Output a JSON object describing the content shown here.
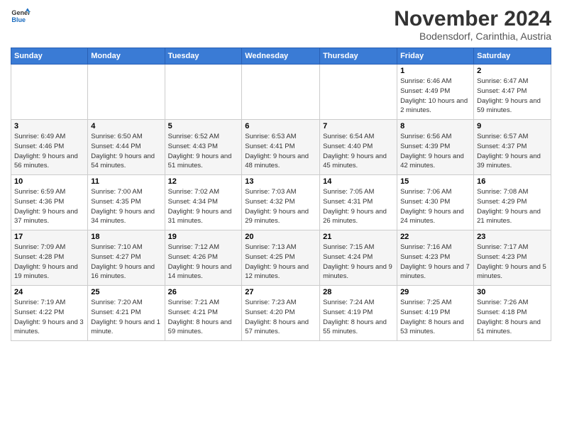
{
  "logo": {
    "text_general": "General",
    "text_blue": "Blue"
  },
  "header": {
    "month_year": "November 2024",
    "location": "Bodensdorf, Carinthia, Austria"
  },
  "weekdays": [
    "Sunday",
    "Monday",
    "Tuesday",
    "Wednesday",
    "Thursday",
    "Friday",
    "Saturday"
  ],
  "weeks": [
    [
      {
        "day": "",
        "info": ""
      },
      {
        "day": "",
        "info": ""
      },
      {
        "day": "",
        "info": ""
      },
      {
        "day": "",
        "info": ""
      },
      {
        "day": "",
        "info": ""
      },
      {
        "day": "1",
        "info": "Sunrise: 6:46 AM\nSunset: 4:49 PM\nDaylight: 10 hours and 2 minutes."
      },
      {
        "day": "2",
        "info": "Sunrise: 6:47 AM\nSunset: 4:47 PM\nDaylight: 9 hours and 59 minutes."
      }
    ],
    [
      {
        "day": "3",
        "info": "Sunrise: 6:49 AM\nSunset: 4:46 PM\nDaylight: 9 hours and 56 minutes."
      },
      {
        "day": "4",
        "info": "Sunrise: 6:50 AM\nSunset: 4:44 PM\nDaylight: 9 hours and 54 minutes."
      },
      {
        "day": "5",
        "info": "Sunrise: 6:52 AM\nSunset: 4:43 PM\nDaylight: 9 hours and 51 minutes."
      },
      {
        "day": "6",
        "info": "Sunrise: 6:53 AM\nSunset: 4:41 PM\nDaylight: 9 hours and 48 minutes."
      },
      {
        "day": "7",
        "info": "Sunrise: 6:54 AM\nSunset: 4:40 PM\nDaylight: 9 hours and 45 minutes."
      },
      {
        "day": "8",
        "info": "Sunrise: 6:56 AM\nSunset: 4:39 PM\nDaylight: 9 hours and 42 minutes."
      },
      {
        "day": "9",
        "info": "Sunrise: 6:57 AM\nSunset: 4:37 PM\nDaylight: 9 hours and 39 minutes."
      }
    ],
    [
      {
        "day": "10",
        "info": "Sunrise: 6:59 AM\nSunset: 4:36 PM\nDaylight: 9 hours and 37 minutes."
      },
      {
        "day": "11",
        "info": "Sunrise: 7:00 AM\nSunset: 4:35 PM\nDaylight: 9 hours and 34 minutes."
      },
      {
        "day": "12",
        "info": "Sunrise: 7:02 AM\nSunset: 4:34 PM\nDaylight: 9 hours and 31 minutes."
      },
      {
        "day": "13",
        "info": "Sunrise: 7:03 AM\nSunset: 4:32 PM\nDaylight: 9 hours and 29 minutes."
      },
      {
        "day": "14",
        "info": "Sunrise: 7:05 AM\nSunset: 4:31 PM\nDaylight: 9 hours and 26 minutes."
      },
      {
        "day": "15",
        "info": "Sunrise: 7:06 AM\nSunset: 4:30 PM\nDaylight: 9 hours and 24 minutes."
      },
      {
        "day": "16",
        "info": "Sunrise: 7:08 AM\nSunset: 4:29 PM\nDaylight: 9 hours and 21 minutes."
      }
    ],
    [
      {
        "day": "17",
        "info": "Sunrise: 7:09 AM\nSunset: 4:28 PM\nDaylight: 9 hours and 19 minutes."
      },
      {
        "day": "18",
        "info": "Sunrise: 7:10 AM\nSunset: 4:27 PM\nDaylight: 9 hours and 16 minutes."
      },
      {
        "day": "19",
        "info": "Sunrise: 7:12 AM\nSunset: 4:26 PM\nDaylight: 9 hours and 14 minutes."
      },
      {
        "day": "20",
        "info": "Sunrise: 7:13 AM\nSunset: 4:25 PM\nDaylight: 9 hours and 12 minutes."
      },
      {
        "day": "21",
        "info": "Sunrise: 7:15 AM\nSunset: 4:24 PM\nDaylight: 9 hours and 9 minutes."
      },
      {
        "day": "22",
        "info": "Sunrise: 7:16 AM\nSunset: 4:23 PM\nDaylight: 9 hours and 7 minutes."
      },
      {
        "day": "23",
        "info": "Sunrise: 7:17 AM\nSunset: 4:23 PM\nDaylight: 9 hours and 5 minutes."
      }
    ],
    [
      {
        "day": "24",
        "info": "Sunrise: 7:19 AM\nSunset: 4:22 PM\nDaylight: 9 hours and 3 minutes."
      },
      {
        "day": "25",
        "info": "Sunrise: 7:20 AM\nSunset: 4:21 PM\nDaylight: 9 hours and 1 minute."
      },
      {
        "day": "26",
        "info": "Sunrise: 7:21 AM\nSunset: 4:21 PM\nDaylight: 8 hours and 59 minutes."
      },
      {
        "day": "27",
        "info": "Sunrise: 7:23 AM\nSunset: 4:20 PM\nDaylight: 8 hours and 57 minutes."
      },
      {
        "day": "28",
        "info": "Sunrise: 7:24 AM\nSunset: 4:19 PM\nDaylight: 8 hours and 55 minutes."
      },
      {
        "day": "29",
        "info": "Sunrise: 7:25 AM\nSunset: 4:19 PM\nDaylight: 8 hours and 53 minutes."
      },
      {
        "day": "30",
        "info": "Sunrise: 7:26 AM\nSunset: 4:18 PM\nDaylight: 8 hours and 51 minutes."
      }
    ]
  ]
}
